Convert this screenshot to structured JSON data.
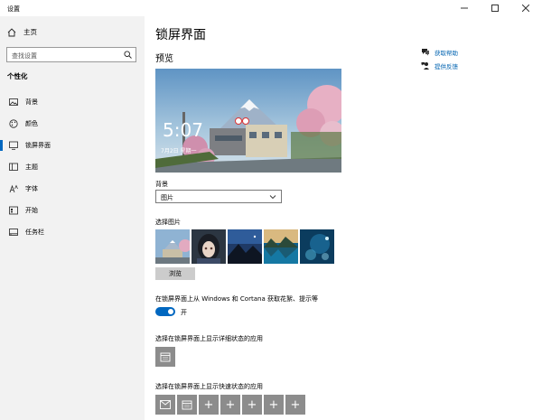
{
  "window": {
    "title": "设置"
  },
  "sidebar": {
    "home_label": "主页",
    "search_placeholder": "查找设置",
    "section_title": "个性化",
    "items": [
      {
        "label": "背景",
        "icon": "image-icon"
      },
      {
        "label": "颜色",
        "icon": "palette-icon"
      },
      {
        "label": "锁屏界面",
        "icon": "monitor-icon",
        "active": true
      },
      {
        "label": "主题",
        "icon": "theme-icon"
      },
      {
        "label": "字体",
        "icon": "font-icon"
      },
      {
        "label": "开始",
        "icon": "start-icon"
      },
      {
        "label": "任务栏",
        "icon": "taskbar-icon"
      }
    ]
  },
  "main": {
    "title": "锁屏界面",
    "preview_label": "预览",
    "preview": {
      "time": "5:07",
      "date": "7月2日 星期一"
    },
    "help": {
      "get_help": "获取帮助",
      "feedback": "提供反馈"
    },
    "background_label": "背景",
    "background_value": "图片",
    "choose_picture_label": "选择图片",
    "browse_label": "浏览",
    "fun_facts_label": "在锁屏界面上从 Windows 和 Cortana 获取花絮、提示等",
    "toggle_state": "开",
    "detailed_status_label": "选择在锁屏界面上显示详细状态的应用",
    "quick_status_label": "选择在锁屏界面上显示快速状态的应用",
    "plus_symbol": "+"
  },
  "colors": {
    "accent": "#0067c0",
    "sidebar_bg": "#f2f2f2",
    "app_tile": "#8c8c8c"
  }
}
